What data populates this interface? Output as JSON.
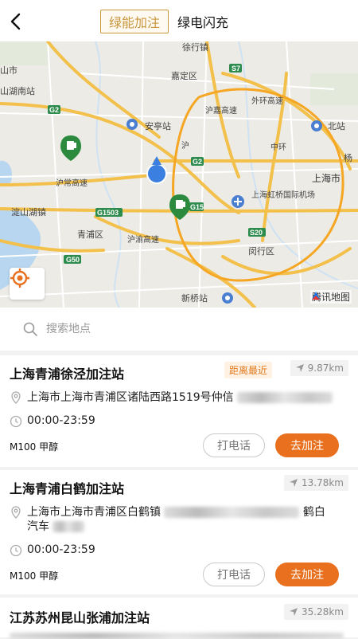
{
  "header": {
    "tabs": [
      {
        "label": "绿能加注",
        "active": true
      },
      {
        "label": "绿电闪充",
        "active": false
      }
    ]
  },
  "map": {
    "labels": {
      "xuhang": "徐行镇",
      "jiading": "嘉定区",
      "anting": "安亭站",
      "shanghai_city": "上海市",
      "huqing": "沪常高速",
      "qingpu": "青浦区",
      "hongqiao": "上海虹桥国际机场",
      "minhang": "闵行区",
      "xinqiao": "新桥站",
      "dianshan": "淀山湖镇",
      "beizhan": "北站",
      "shan_lake": "山湖南站",
      "yang": "杨",
      "huyu": "沪渝高速",
      "hujia": "沪嘉高速",
      "zhonghuan": "中环",
      "huanxiang": "外环高速",
      "hushan": "沪",
      "s_left": "山市"
    },
    "shields": [
      "S7",
      "S7",
      "G2",
      "G2",
      "G15",
      "G1503",
      "G50",
      "S20"
    ],
    "provider": "腾讯地图"
  },
  "search": {
    "placeholder": "搜索地点"
  },
  "stations": [
    {
      "name": "上海青浦徐泾加注站",
      "badge": "距离最近",
      "distance": "9.87km",
      "address": "上海市上海市青浦区诸陆西路1519号仲信",
      "hours": "00:00-23:59",
      "fuel": "M100 甲醇",
      "call_label": "打电话",
      "go_label": "去加注"
    },
    {
      "name": "上海青浦白鹤加注站",
      "distance": "13.78km",
      "address": "上海市上海市青浦区白鹤镇",
      "address_tail": "鹤白",
      "address_line2": "汽车",
      "hours": "00:00-23:59",
      "fuel": "M100 甲醇",
      "call_label": "打电话",
      "go_label": "去加注"
    },
    {
      "name": "江苏苏州昆山张浦加注站",
      "distance": "35.28km"
    }
  ],
  "colors": {
    "accent": "#c8963c",
    "action": "#e8701e",
    "badge_text": "#e07b20",
    "map_marker": "#2b8a3e"
  }
}
